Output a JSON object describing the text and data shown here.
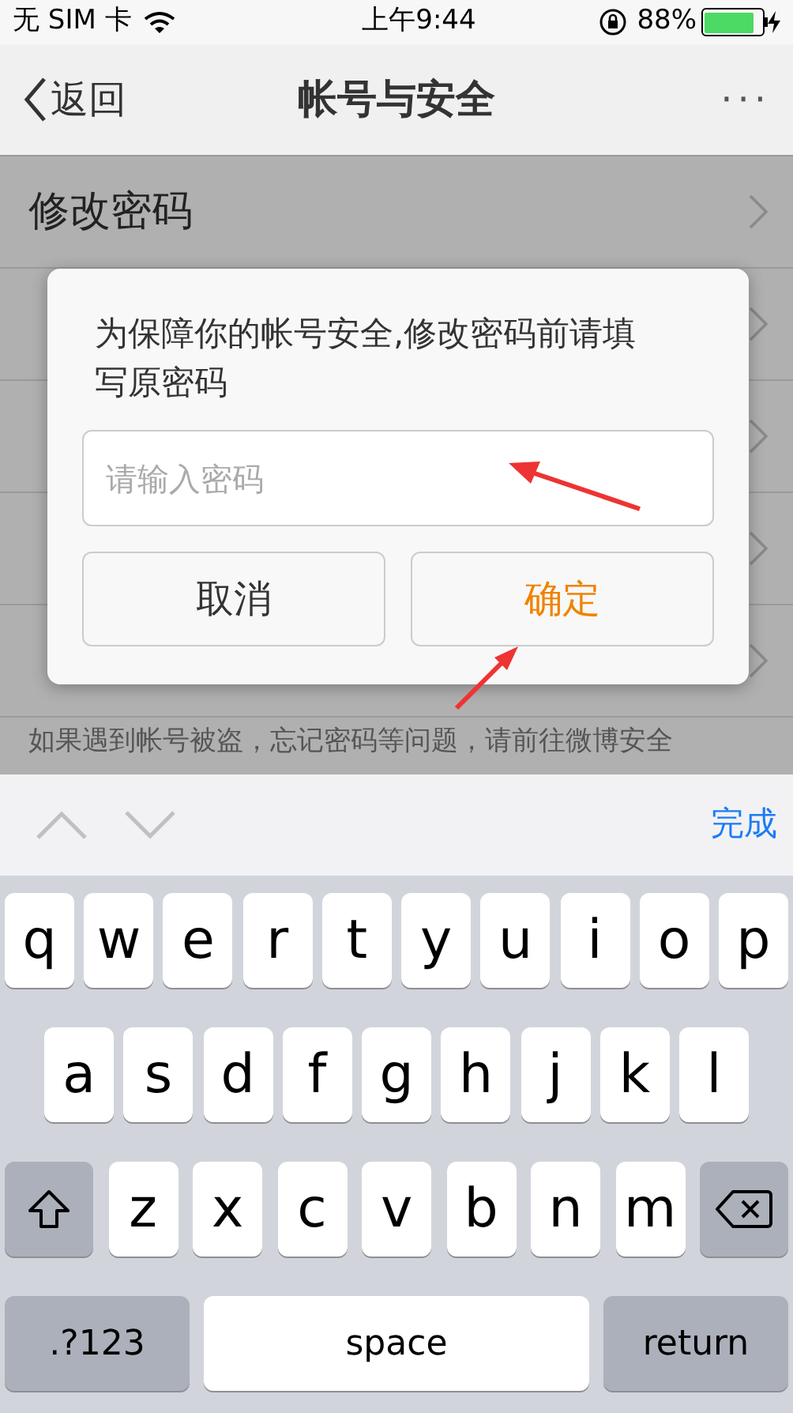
{
  "status_bar": {
    "carrier": "无 SIM 卡",
    "time": "上午9:44",
    "battery_text": "88%",
    "battery": {
      "level": 0.88
    }
  },
  "nav": {
    "back": "返回",
    "title": "帐号与安全",
    "more": "···"
  },
  "list": {
    "items": [
      {
        "kind": "labeled",
        "label": "修改密码"
      },
      {
        "kind": "covered"
      },
      {
        "kind": "covered"
      },
      {
        "kind": "covered"
      },
      {
        "kind": "covered"
      }
    ],
    "footer": "如果遇到帐号被盗，忘记密码等问题，请前往微博安全"
  },
  "dialog": {
    "message": "为保障你的帐号安全,修改密码前请填写原密码",
    "input": {
      "placeholder": "请输入密码"
    },
    "buttons": [
      {
        "label": "取消",
        "primary": false
      },
      {
        "label": "确定",
        "primary": true
      }
    ]
  },
  "keyboard": {
    "done": "完成",
    "rows": [
      {
        "keys": [
          {
            "kind": "letter",
            "label": "q"
          },
          {
            "kind": "letter",
            "label": "w"
          },
          {
            "kind": "letter",
            "label": "e"
          },
          {
            "kind": "letter",
            "label": "r"
          },
          {
            "kind": "letter",
            "label": "t"
          },
          {
            "kind": "letter",
            "label": "y"
          },
          {
            "kind": "letter",
            "label": "u"
          },
          {
            "kind": "letter",
            "label": "i"
          },
          {
            "kind": "letter",
            "label": "o"
          },
          {
            "kind": "letter",
            "label": "p"
          }
        ]
      },
      {
        "keys": [
          {
            "kind": "letter",
            "label": "a"
          },
          {
            "kind": "letter",
            "label": "s"
          },
          {
            "kind": "letter",
            "label": "d"
          },
          {
            "kind": "letter",
            "label": "f"
          },
          {
            "kind": "letter",
            "label": "g"
          },
          {
            "kind": "letter",
            "label": "h"
          },
          {
            "kind": "letter",
            "label": "j"
          },
          {
            "kind": "letter",
            "label": "k"
          },
          {
            "kind": "letter",
            "label": "l"
          }
        ]
      },
      {
        "keys": [
          {
            "kind": "shift"
          },
          {
            "kind": "letter",
            "label": "z"
          },
          {
            "kind": "letter",
            "label": "x"
          },
          {
            "kind": "letter",
            "label": "c"
          },
          {
            "kind": "letter",
            "label": "v"
          },
          {
            "kind": "letter",
            "label": "b"
          },
          {
            "kind": "letter",
            "label": "n"
          },
          {
            "kind": "letter",
            "label": "m"
          },
          {
            "kind": "delete"
          }
        ]
      }
    ],
    "bottom_row": [
      {
        "kind": "mode",
        "label": ".?123"
      },
      {
        "kind": "space",
        "label": "space"
      },
      {
        "kind": "return",
        "label": "return"
      }
    ]
  }
}
